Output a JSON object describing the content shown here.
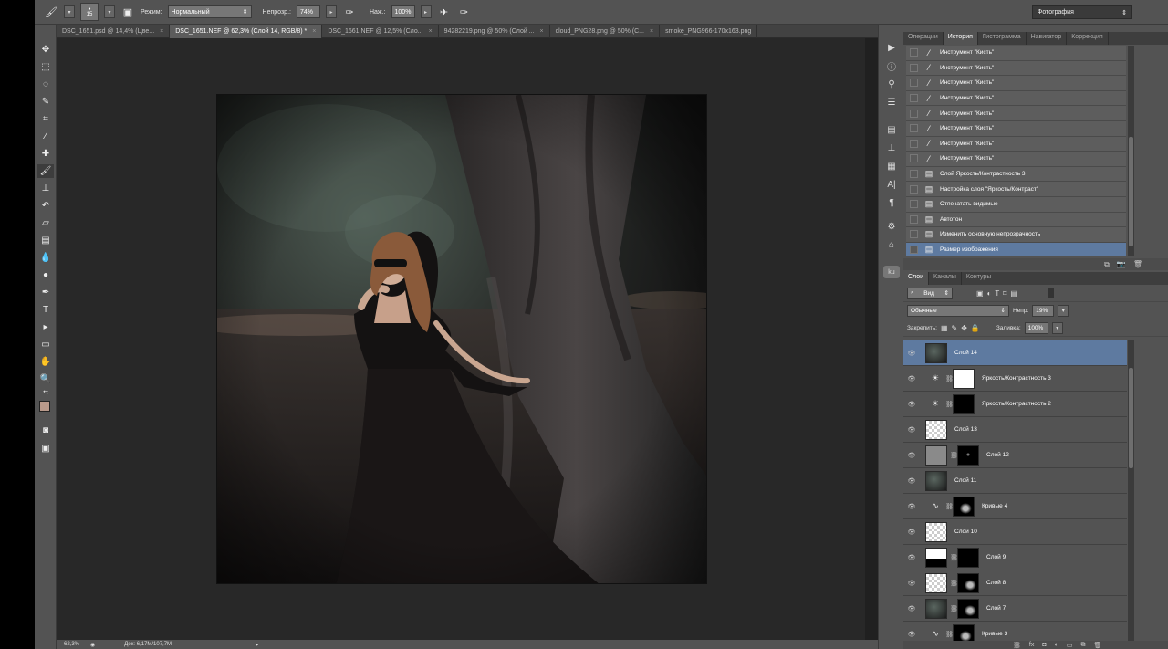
{
  "options_bar": {
    "brush_size": "15",
    "mode_label": "Режим:",
    "mode_value": "Нормальный",
    "opacity_label": "Непрозр.:",
    "opacity_value": "74%",
    "flow_label": "Наж.:",
    "flow_value": "100%",
    "workspace": "Фотография"
  },
  "tabs": [
    {
      "label": "DSC_1651.psd @ 14,4% (Цве..."
    },
    {
      "label": "DSC_1651.NEF @ 62,3% (Слой 14, RGB/8) *"
    },
    {
      "label": "DSC_1661.NEF @ 12,5% (Сло..."
    },
    {
      "label": "94282219.png @ 50% (Слой ..."
    },
    {
      "label": "cloud_PNG28.png @ 50% (C..."
    },
    {
      "label": "smoke_PNG966-170x163.png"
    }
  ],
  "tab_close": "×",
  "status": {
    "zoom": "62,3%",
    "doc": "Док: 6,17M/107,7M"
  },
  "colors": {
    "foreground": "#b8998a",
    "background": "#ffffff",
    "selection": "#5e7aa0",
    "panel": "#535353"
  },
  "history_tabs": [
    "Операции",
    "История",
    "Гистограмма",
    "Навигатор",
    "Коррекция"
  ],
  "history": [
    {
      "label": "Инструмент \"Кисть\"",
      "icon": "brush-icon"
    },
    {
      "label": "Инструмент \"Кисть\"",
      "icon": "brush-icon"
    },
    {
      "label": "Инструмент \"Кисть\"",
      "icon": "brush-icon"
    },
    {
      "label": "Инструмент \"Кисть\"",
      "icon": "brush-icon"
    },
    {
      "label": "Инструмент \"Кисть\"",
      "icon": "brush-icon"
    },
    {
      "label": "Инструмент \"Кисть\"",
      "icon": "brush-icon"
    },
    {
      "label": "Инструмент \"Кисть\"",
      "icon": "brush-icon"
    },
    {
      "label": "Инструмент \"Кисть\"",
      "icon": "brush-icon"
    },
    {
      "label": "Слой Яркость/Контрастность 3",
      "icon": "document-icon"
    },
    {
      "label": "Настройка слоя \"Яркость/Контраст\"",
      "icon": "document-icon"
    },
    {
      "label": "Отпечатать видимые",
      "icon": "document-icon"
    },
    {
      "label": "Автотон",
      "icon": "document-icon"
    },
    {
      "label": "Изменить основную непрозрачность",
      "icon": "document-icon"
    },
    {
      "label": "Размер изображения",
      "icon": "document-icon"
    }
  ],
  "layers_tabs": [
    "Слои",
    "Каналы",
    "Контуры"
  ],
  "layers_controls": {
    "filter": "Вид",
    "blend": "Обычные",
    "opacity_label": "Непр:",
    "opacity_value": "19%",
    "lock_label": "Закрепить:",
    "fill_label": "Заливка:",
    "fill_value": "100%"
  },
  "layers": [
    {
      "name": "Слой 14",
      "type": "photo",
      "selected": true
    },
    {
      "name": "Яркость/Контрастность 3",
      "type": "adjust",
      "mask": "white"
    },
    {
      "name": "Яркость/Контрастность 2",
      "type": "adjust",
      "mask": "black"
    },
    {
      "name": "Слой 13",
      "type": "transparent"
    },
    {
      "name": "Слой 12",
      "type": "gray",
      "mask": "black-dot"
    },
    {
      "name": "Слой 11",
      "type": "photo"
    },
    {
      "name": "Кривые 4",
      "type": "curves",
      "mask": "black-shape"
    },
    {
      "name": "Слой 10",
      "type": "transparent"
    },
    {
      "name": "Слой 9",
      "type": "white-black",
      "mask": "black"
    },
    {
      "name": "Слой 8",
      "type": "transparent",
      "mask": "black-shape"
    },
    {
      "name": "Слой 7",
      "type": "photo",
      "mask": "black-shape"
    },
    {
      "name": "Кривые 3",
      "type": "curves",
      "mask": "black-shape"
    }
  ]
}
